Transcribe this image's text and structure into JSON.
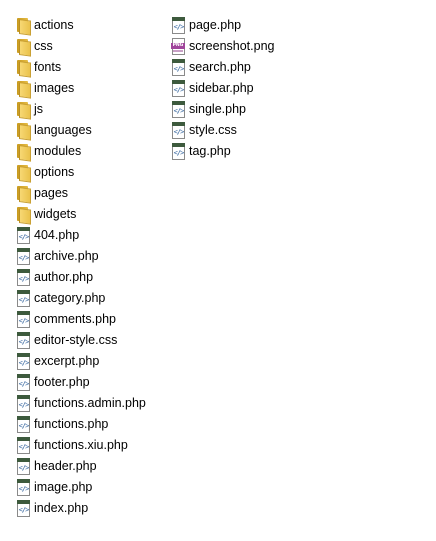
{
  "explorer": {
    "left_column": [
      {
        "label": "actions",
        "icon": "folder-icon"
      },
      {
        "label": "css",
        "icon": "folder-icon"
      },
      {
        "label": "fonts",
        "icon": "folder-icon"
      },
      {
        "label": "images",
        "icon": "folder-icon"
      },
      {
        "label": "js",
        "icon": "folder-icon"
      },
      {
        "label": "languages",
        "icon": "folder-icon"
      },
      {
        "label": "modules",
        "icon": "folder-icon"
      },
      {
        "label": "options",
        "icon": "folder-icon"
      },
      {
        "label": "pages",
        "icon": "folder-icon"
      },
      {
        "label": "widgets",
        "icon": "folder-icon"
      },
      {
        "label": "404.php",
        "icon": "php-file-icon"
      },
      {
        "label": "archive.php",
        "icon": "php-file-icon"
      },
      {
        "label": "author.php",
        "icon": "php-file-icon"
      },
      {
        "label": "category.php",
        "icon": "php-file-icon"
      },
      {
        "label": "comments.php",
        "icon": "php-file-icon"
      },
      {
        "label": "editor-style.css",
        "icon": "css-file-icon"
      },
      {
        "label": "excerpt.php",
        "icon": "php-file-icon"
      },
      {
        "label": "footer.php",
        "icon": "php-file-icon"
      },
      {
        "label": "functions.admin.php",
        "icon": "php-file-icon"
      },
      {
        "label": "functions.php",
        "icon": "php-file-icon"
      },
      {
        "label": "functions.xiu.php",
        "icon": "php-file-icon"
      },
      {
        "label": "header.php",
        "icon": "php-file-icon"
      },
      {
        "label": "image.php",
        "icon": "php-file-icon"
      },
      {
        "label": "index.php",
        "icon": "php-file-icon"
      }
    ],
    "right_column": [
      {
        "label": "page.php",
        "icon": "php-file-icon"
      },
      {
        "label": "screenshot.png",
        "icon": "png-file-icon"
      },
      {
        "label": "search.php",
        "icon": "php-file-icon"
      },
      {
        "label": "sidebar.php",
        "icon": "php-file-icon"
      },
      {
        "label": "single.php",
        "icon": "php-file-icon"
      },
      {
        "label": "style.css",
        "icon": "css-file-icon"
      },
      {
        "label": "tag.php",
        "icon": "php-file-icon"
      }
    ]
  }
}
